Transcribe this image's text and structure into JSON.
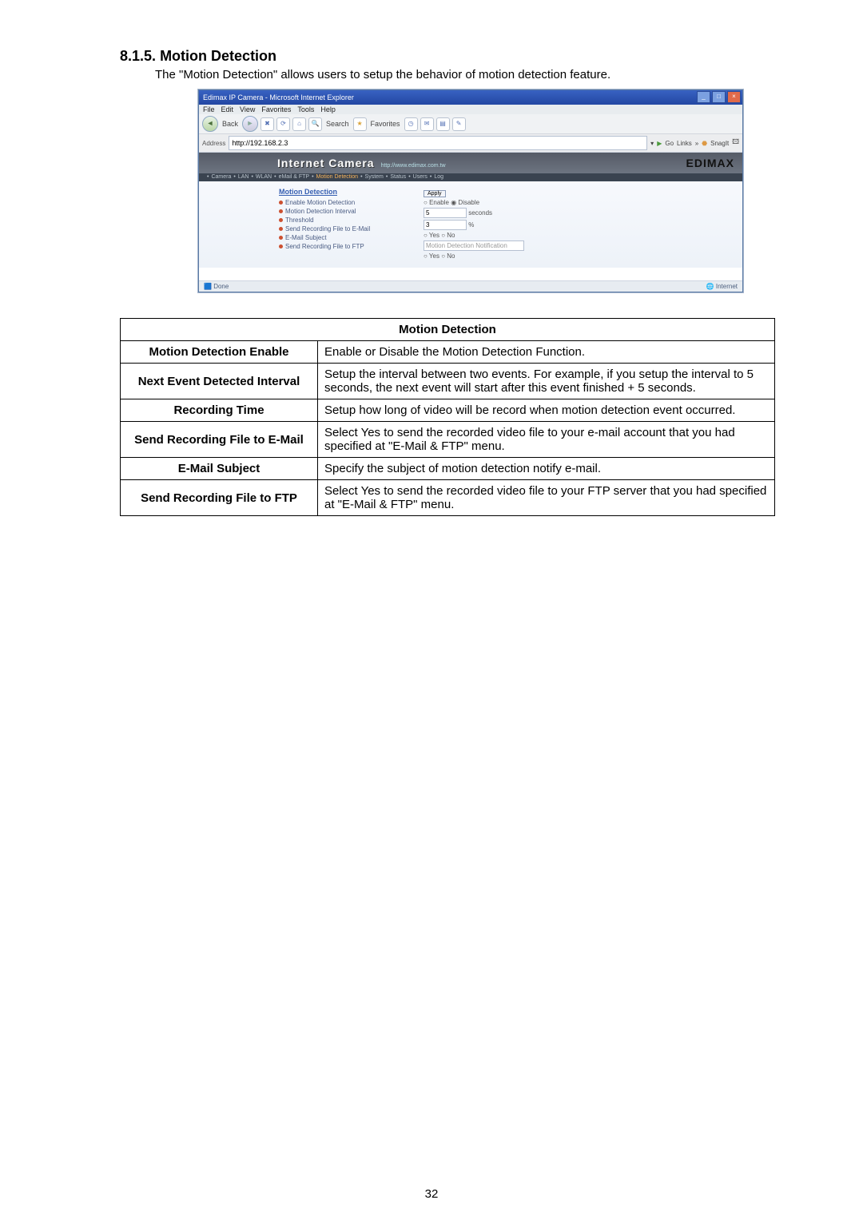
{
  "section": {
    "number": "8.1.5.",
    "title": "Motion Detection",
    "intro": "The \"Motion Detection\" allows users to setup the behavior of motion detection feature."
  },
  "page_number": "32",
  "screenshot": {
    "window_title": "Edimax IP Camera - Microsoft Internet Explorer",
    "menu": [
      "File",
      "Edit",
      "View",
      "Favorites",
      "Tools",
      "Help"
    ],
    "toolbar": {
      "back": "Back",
      "search": "Search",
      "favorites": "Favorites"
    },
    "address_label": "Address",
    "address_value": "http://192.168.2.3",
    "go_label": "Go",
    "links_label": "Links",
    "snagit_label": "SnagIt",
    "hero_title": "Internet Camera",
    "hero_sub": "http://www.edimax.com.tw",
    "brand": "EDIMAX",
    "tabs": [
      "Camera",
      "LAN",
      "WLAN",
      "eMail & FTP",
      "Motion Detection",
      "System",
      "Status",
      "Users",
      "Log"
    ],
    "section_title": "Motion Detection",
    "apply_label": "Apply",
    "rows": {
      "enable_label": "Enable Motion Detection",
      "enable_opt1": "Enable",
      "enable_opt2": "Disable",
      "interval_label": "Motion Detection Interval",
      "interval_value": "5",
      "interval_unit": "seconds",
      "threshold_label": "Threshold",
      "threshold_value": "3",
      "send_email_label": "Send Recording File to E-Mail",
      "subject_label": "E-Mail Subject",
      "subject_value": "Motion Detection Notification",
      "send_ftp_label": "Send Recording File to FTP",
      "yes": "Yes",
      "no": "No"
    },
    "status_left": "Done",
    "status_right": "Internet"
  },
  "table": {
    "header": "Motion Detection",
    "rows": [
      {
        "label": "Motion Detection Enable",
        "desc": "Enable or Disable the Motion Detection Function."
      },
      {
        "label": "Next Event Detected Interval",
        "desc": "Setup the interval between two events. For example, if you setup the interval to 5 seconds, the next event will start after this event finished + 5 seconds."
      },
      {
        "label": "Recording Time",
        "desc": "Setup how long of video will be record when motion detection event occurred."
      },
      {
        "label": "Send Recording File to E-Mail",
        "desc": "Select Yes to send the recorded video file to your e-mail account that you had specified at \"E-Mail & FTP\" menu."
      },
      {
        "label": "E-Mail Subject",
        "desc": "Specify the subject of motion detection notify e-mail."
      },
      {
        "label": "Send Recording File to FTP",
        "desc": "Select Yes to send the recorded video file to your FTP server that you had specified at \"E-Mail & FTP\" menu."
      }
    ]
  }
}
